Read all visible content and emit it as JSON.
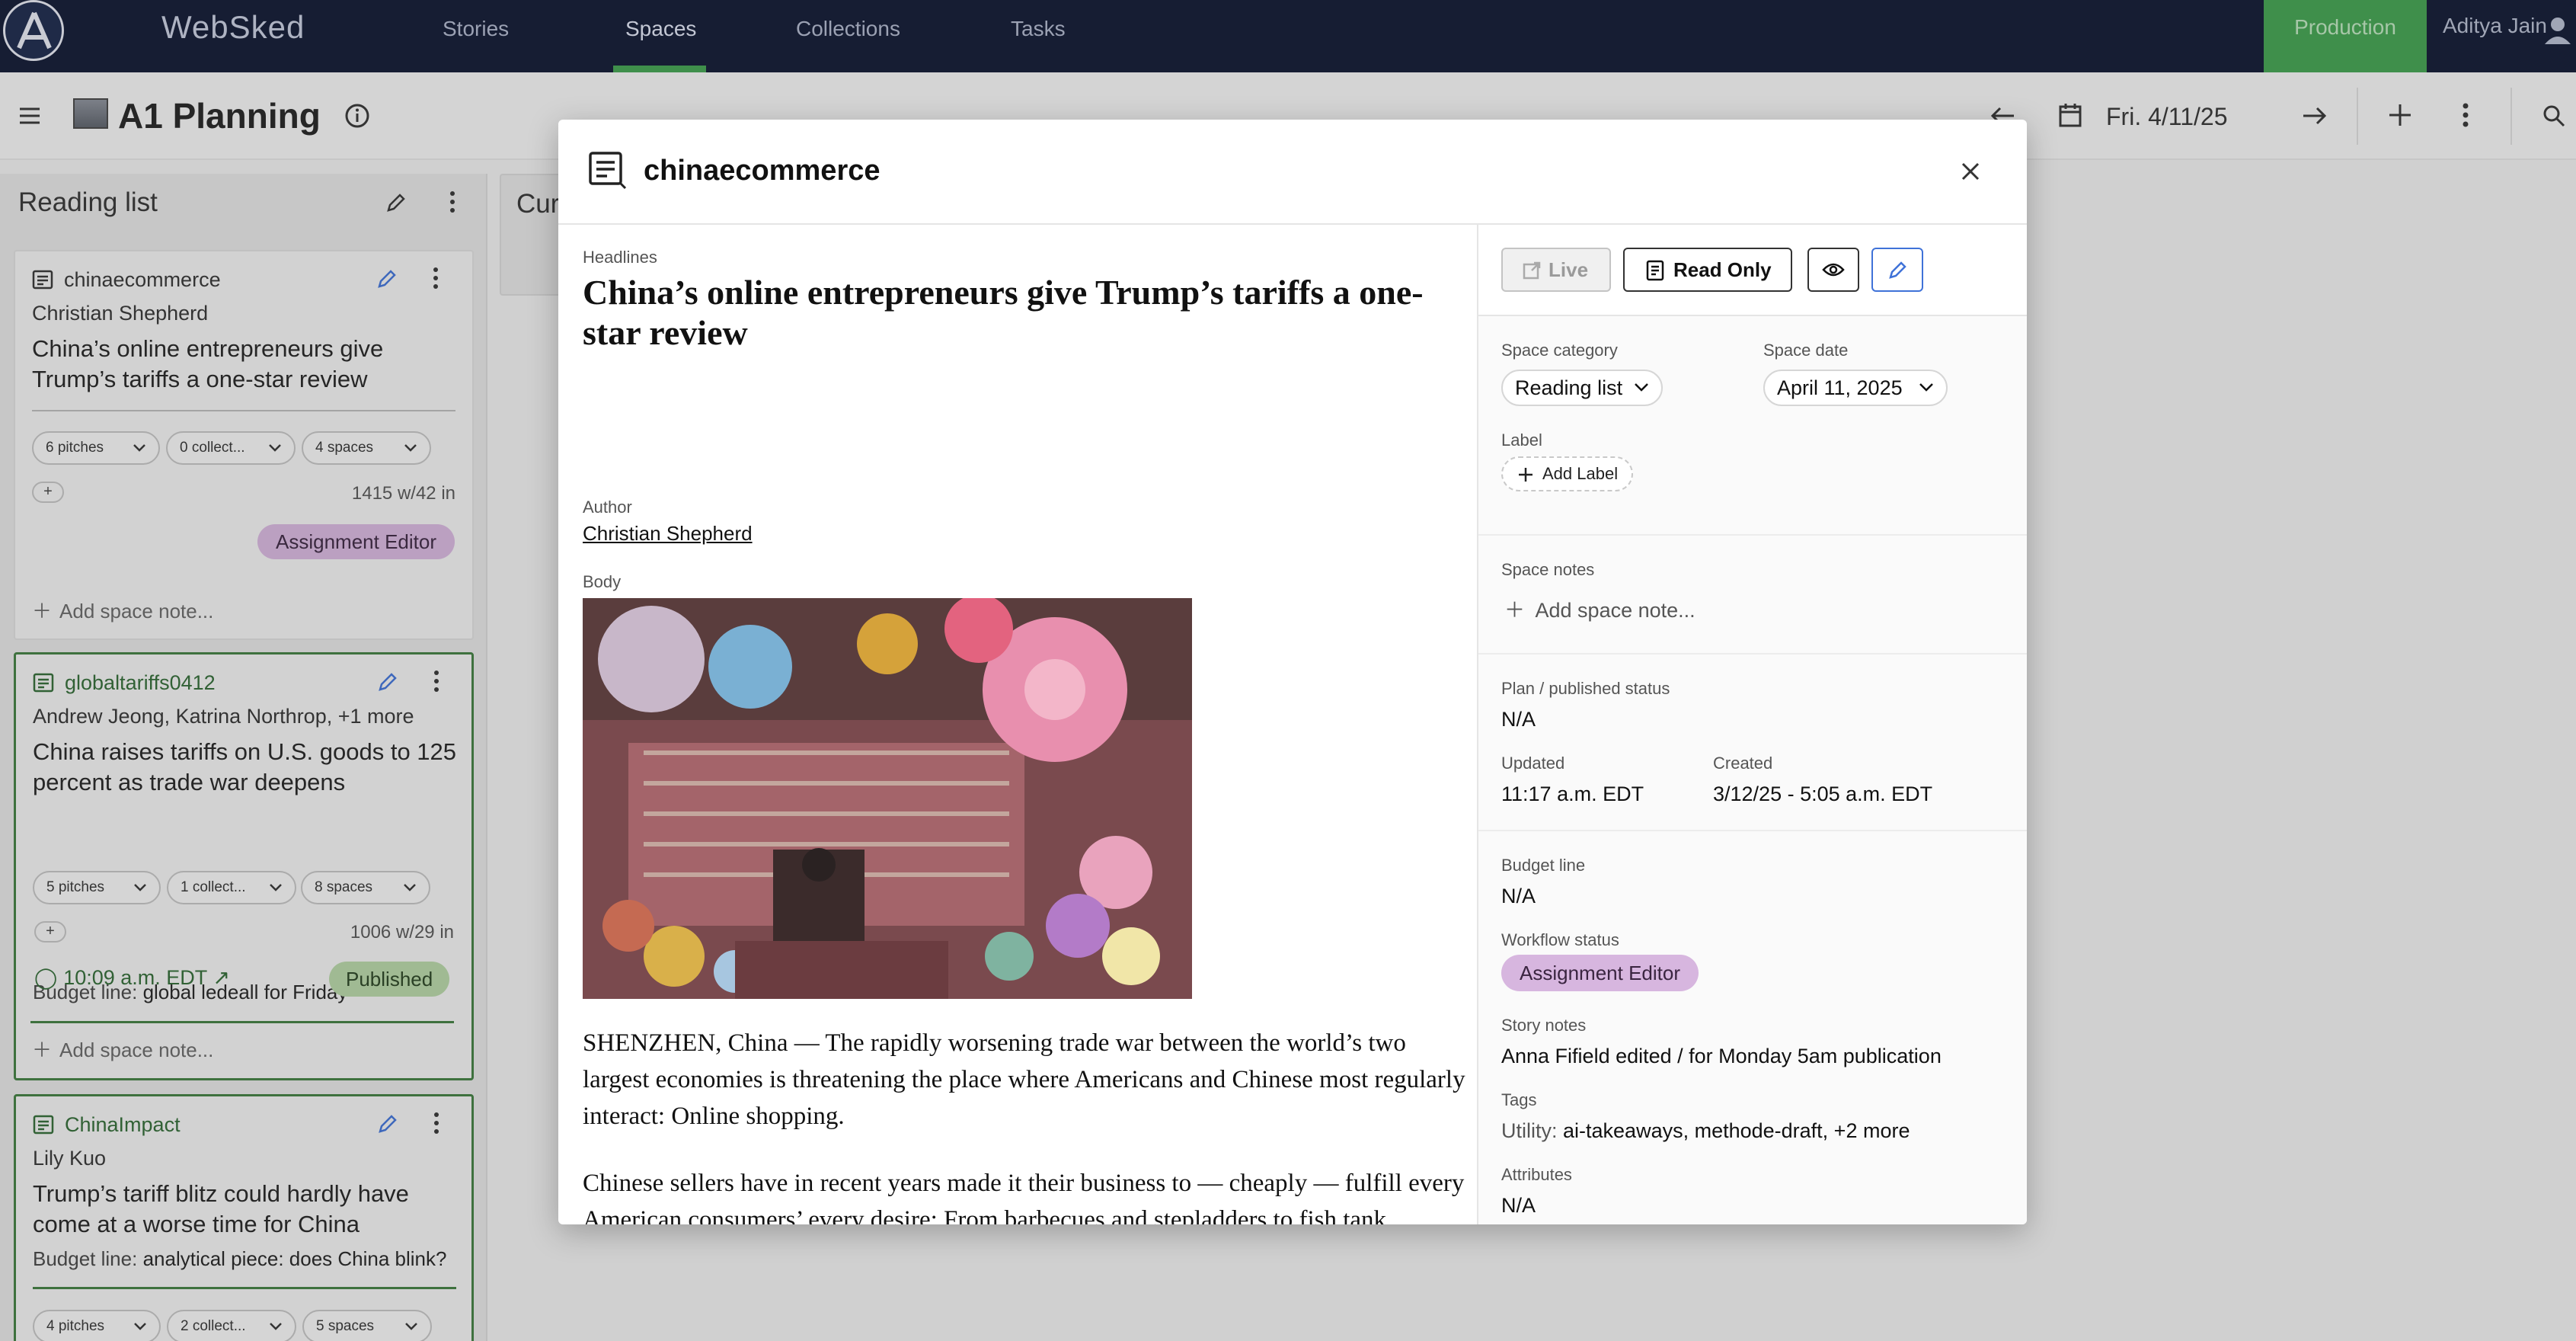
{
  "app": {
    "brand": "WebSked",
    "nav_tabs": [
      "Stories",
      "Spaces",
      "Collections",
      "Tasks"
    ],
    "active_tab": "Spaces",
    "environment": "Production",
    "user_name": "Aditya Jain"
  },
  "toolbar": {
    "page_title": "A1 Planning",
    "date": "Fri. 4/11/25"
  },
  "column": {
    "title": "Reading list",
    "second_column_title": "Cur",
    "cards": [
      {
        "slug": "chinaecommerce",
        "byline": "Christian Shepherd",
        "headline": "China’s online entrepreneurs give Trump’s tariffs a one-star review",
        "pitches": "6 pitches",
        "collections": "0 collect...",
        "spaces": "4 spaces",
        "word_count": "1415 w/42 in",
        "status": "Assignment Editor",
        "add_note": "Add space note..."
      },
      {
        "slug": "globaltariffs0412",
        "byline": "Andrew Jeong, Katrina Northrop, +1 more",
        "headline": "China raises tariffs on U.S. goods to 125 percent as trade war deepens",
        "budget_label": "Budget line:",
        "budget_value": "global ledeall for Friday",
        "pitches": "5 pitches",
        "collections": "1 collect...",
        "spaces": "8 spaces",
        "word_count": "1006 w/29 in",
        "published_time": "10:09 a.m. EDT",
        "status": "Published",
        "add_note": "Add space note..."
      },
      {
        "slug": "ChinaImpact",
        "byline": "Lily Kuo",
        "headline": "Trump’s tariff blitz could hardly have come at a worse time for China",
        "budget_label": "Budget line:",
        "budget_value": "analytical piece: does China blink?",
        "pitches": "4 pitches",
        "collections": "2 collect...",
        "spaces": "5 spaces"
      }
    ]
  },
  "modal": {
    "title": "chinaecommerce",
    "headlines_label": "Headlines",
    "headline": "China’s online entrepreneurs give Trump’s tariffs a one-star review",
    "author_label": "Author",
    "author": "Christian Shepherd",
    "body_label": "Body",
    "paragraphs": [
      "SHENZHEN, China — The rapidly worsening trade war between the world’s two largest economies is threatening the place where Americans and Chinese most regularly interact: Online shopping.",
      "Chinese sellers have in recent years made it their business to — cheaply — fulfill every American consumers’ every desire: From barbecues and stepladders to fish tank speakers and tabletop washing machines. They’ve usually arrived on American doorsteps via fashion giant Shein, direct-buy retailer Temu or Amazon."
    ],
    "buttons": {
      "live": "Live",
      "read_only": "Read Only"
    },
    "fields": {
      "space_category_label": "Space category",
      "space_category": "Reading list",
      "space_date_label": "Space date",
      "space_date": "April 11, 2025",
      "label_label": "Label",
      "add_label": "Add Label",
      "space_notes_label": "Space notes",
      "add_space_note": "Add space note...",
      "plan_status_label": "Plan / published status",
      "plan_status": "N/A",
      "updated_label": "Updated",
      "updated": "11:17 a.m. EDT",
      "created_label": "Created",
      "created": "3/12/25 - 5:05 a.m. EDT",
      "budget_line_label": "Budget line",
      "budget_line": "N/A",
      "workflow_label": "Workflow status",
      "workflow": "Assignment Editor",
      "story_notes_label": "Story notes",
      "story_notes": "Anna Fifield edited / for Monday 5am publication",
      "tags_label": "Tags",
      "tags_prefix": "Utility:",
      "tags": "ai-takeaways, methode-draft, +2 more",
      "attributes_label": "Attributes",
      "attributes": "N/A"
    }
  },
  "colors": {
    "nav_bg": "#161d33",
    "production_green": "#3f8f4b",
    "status_purple": "#d7b6df",
    "status_green": "#b6d6a6",
    "edit_blue": "#3f72d8"
  }
}
